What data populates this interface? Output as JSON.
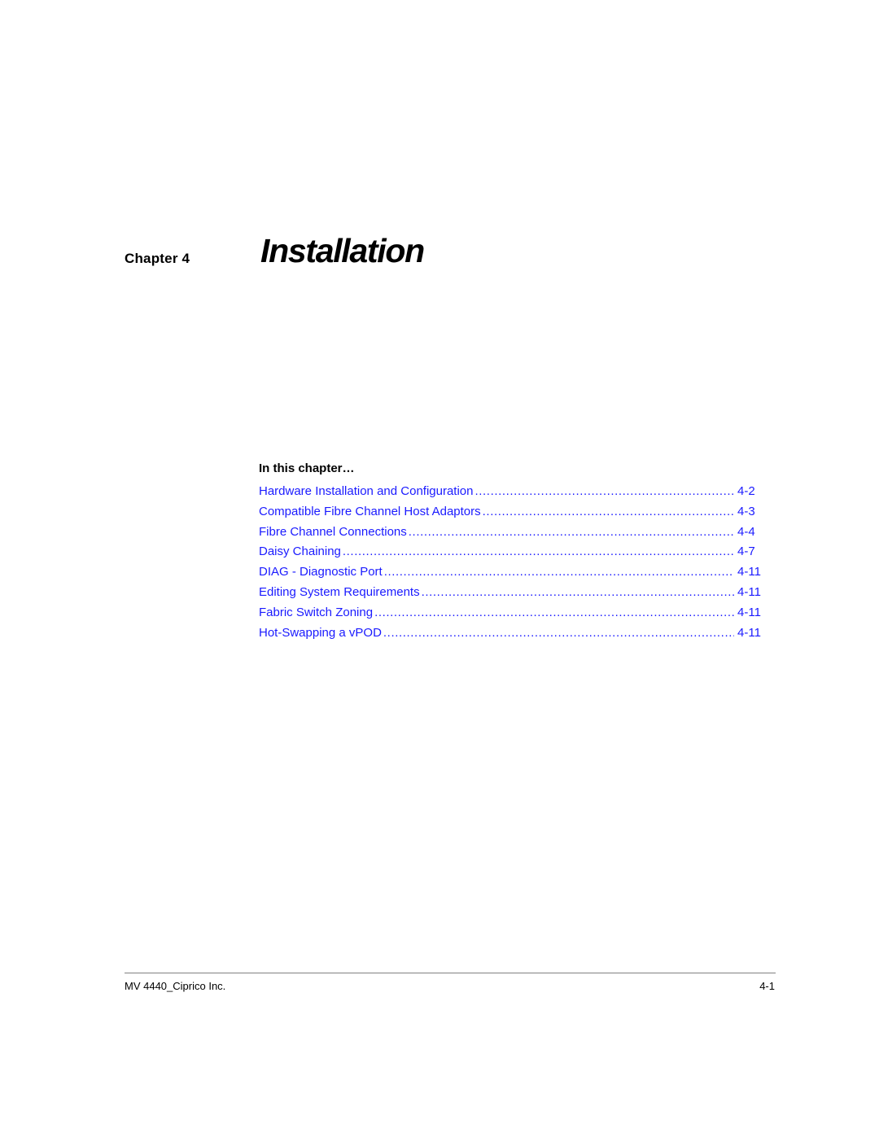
{
  "chapter": {
    "label": "Chapter 4",
    "title": "Installation"
  },
  "toc": {
    "heading": "In this chapter…",
    "link_color": "#1a1aff",
    "entries": [
      {
        "title": "Hardware Installation and Configuration",
        "page": "4-2"
      },
      {
        "title": "Compatible Fibre Channel Host Adaptors",
        "page": "4-3"
      },
      {
        "title": "Fibre Channel Connections",
        "page": "4-4"
      },
      {
        "title": "Daisy Chaining",
        "page": "4-7"
      },
      {
        "title": "DIAG - Diagnostic Port",
        "page": "4-11"
      },
      {
        "title": "Editing System Requirements",
        "page": "4-11"
      },
      {
        "title": "Fabric Switch Zoning",
        "page": "4-11"
      },
      {
        "title": "Hot-Swapping a vPOD",
        "page": "4-11"
      }
    ]
  },
  "footer": {
    "document": "MV 4440_Ciprico Inc.",
    "page_number": "4-1"
  }
}
